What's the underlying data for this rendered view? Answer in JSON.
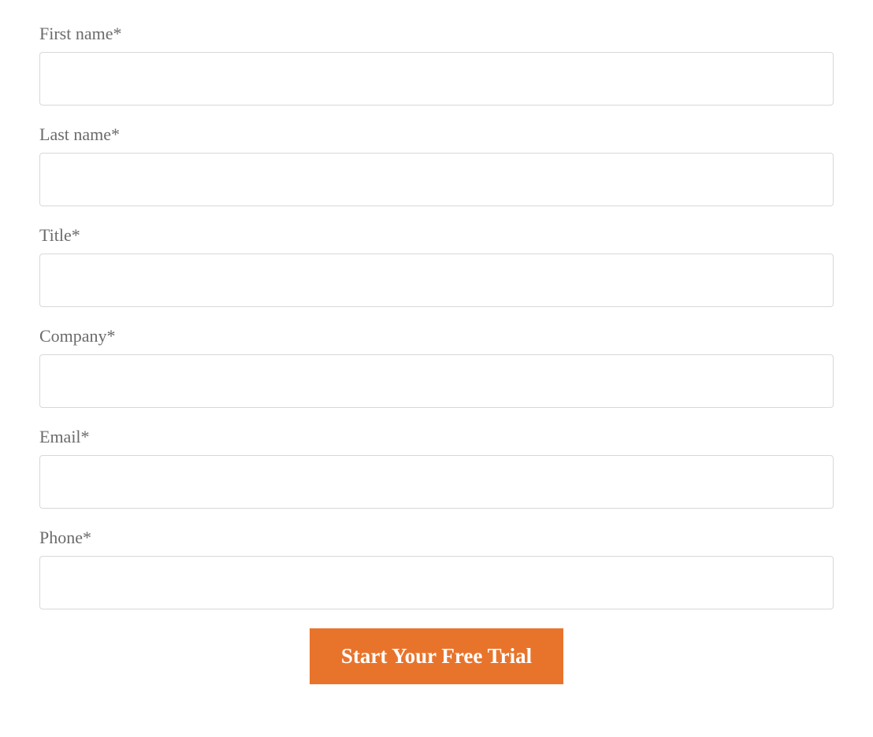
{
  "form": {
    "fields": {
      "first_name": {
        "label": "First name*",
        "value": ""
      },
      "last_name": {
        "label": "Last name*",
        "value": ""
      },
      "title": {
        "label": "Title*",
        "value": ""
      },
      "company": {
        "label": "Company*",
        "value": ""
      },
      "email": {
        "label": "Email*",
        "value": ""
      },
      "phone": {
        "label": "Phone*",
        "value": ""
      }
    },
    "submit_label": "Start Your Free Trial"
  },
  "colors": {
    "accent": "#e8742c",
    "label_text": "#6b6b6b",
    "input_border": "#d8d8d8"
  }
}
